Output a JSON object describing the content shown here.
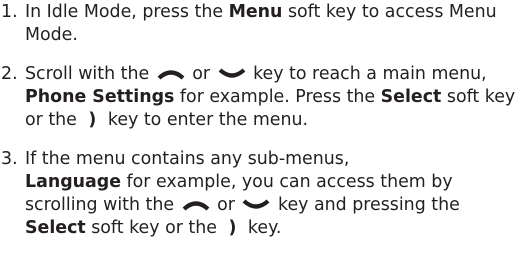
{
  "steps": [
    {
      "number": "1.",
      "text_a": "In Idle Mode, press the ",
      "bold_a": "Menu",
      "text_b": " soft key to access Menu Mode."
    },
    {
      "number": "2.",
      "text_a": "Scroll with the ",
      "icon_up": "up-key-icon",
      "text_or": " or ",
      "icon_down": "down-key-icon",
      "text_b": " key to reach a main menu, ",
      "bold_a": "Phone Settings",
      "text_c": " for example. Press the ",
      "bold_b": "Select",
      "text_d": " soft key or the ",
      "glyph_right": ")",
      "text_e": " key to enter the menu."
    },
    {
      "number": "3.",
      "text_a": "If the menu contains any sub-menus,",
      "bold_a": "Language",
      "text_b": " for example, you can access them by scrolling with the ",
      "icon_up": "up-key-icon",
      "text_or": " or ",
      "icon_down": "down-key-icon",
      "text_c": " key and pressing the ",
      "bold_b": "Select",
      "text_d": " soft key or the ",
      "glyph_right": ")",
      "text_e": " key."
    }
  ]
}
